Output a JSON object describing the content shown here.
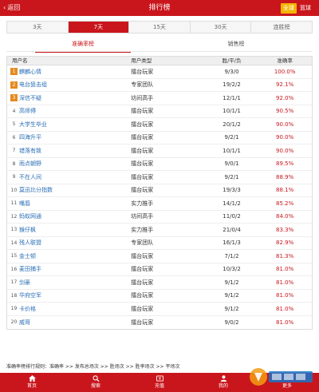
{
  "header": {
    "back_label": "返回",
    "title": "排行榜",
    "ball_label": "全球",
    "sport_label": "篮球"
  },
  "periods": [
    {
      "label": "3天",
      "active": false
    },
    {
      "label": "7天",
      "active": true
    },
    {
      "label": "15天",
      "active": false
    },
    {
      "label": "30天",
      "active": false
    },
    {
      "label": "连胜榜",
      "active": false
    }
  ],
  "subtabs": {
    "accuracy": "准确率榜",
    "sales": "销售榜"
  },
  "table": {
    "headers": {
      "user": "用户名",
      "type": "用户类型",
      "record": "胜/平/负",
      "rate": "准确率"
    },
    "rows": [
      {
        "rank": "1",
        "name": "麒麟心情",
        "type": "擂台玩家",
        "record": "9/3/0",
        "rate": "100.0%"
      },
      {
        "rank": "2",
        "name": "电台狙击组",
        "type": "专家团队",
        "record": "19/2/2",
        "rate": "92.1%"
      },
      {
        "rank": "3",
        "name": "深信不疑",
        "type": "坊间高手",
        "record": "12/1/1",
        "rate": "92.0%"
      },
      {
        "rank": "4",
        "name": "高师傅",
        "type": "擂台玩家",
        "record": "10/1/1",
        "rate": "90.5%"
      },
      {
        "rank": "5",
        "name": "大学生毕业",
        "type": "擂台玩家",
        "record": "20/1/2",
        "rate": "90.0%"
      },
      {
        "rank": "6",
        "name": "四海升平",
        "type": "擂台玩家",
        "record": "9/2/1",
        "rate": "90.0%"
      },
      {
        "rank": "7",
        "name": "错落有致",
        "type": "擂台玩家",
        "record": "10/1/1",
        "rate": "90.0%"
      },
      {
        "rank": "8",
        "name": "雨点朝野",
        "type": "擂台玩家",
        "record": "9/0/1",
        "rate": "89.5%"
      },
      {
        "rank": "9",
        "name": "不在人间",
        "type": "擂台玩家",
        "record": "9/2/1",
        "rate": "88.9%"
      },
      {
        "rank": "10",
        "name": "莫迅比分指数",
        "type": "擂台玩家",
        "record": "19/3/3",
        "rate": "88.1%"
      },
      {
        "rank": "11",
        "name": "嘴唇",
        "type": "实力推手",
        "record": "14/1/2",
        "rate": "85.2%"
      },
      {
        "rank": "12",
        "name": "蚂蚁网通",
        "type": "坊间高手",
        "record": "11/0/2",
        "rate": "84.0%"
      },
      {
        "rank": "13",
        "name": "猴仔枫",
        "type": "实力推手",
        "record": "21/0/4",
        "rate": "83.3%"
      },
      {
        "rank": "14",
        "name": "残人联盟",
        "type": "专家团队",
        "record": "16/1/3",
        "rate": "82.9%"
      },
      {
        "rank": "15",
        "name": "金士顿",
        "type": "擂台玩家",
        "record": "7/1/2",
        "rate": "81.3%"
      },
      {
        "rank": "16",
        "name": "麦田捕手",
        "type": "擂台玩家",
        "record": "10/3/2",
        "rate": "81.0%"
      },
      {
        "rank": "17",
        "name": "剑豪",
        "type": "擂台玩家",
        "record": "9/1/2",
        "rate": "81.0%"
      },
      {
        "rank": "18",
        "name": "华府空军",
        "type": "擂台玩家",
        "record": "9/1/2",
        "rate": "81.0%"
      },
      {
        "rank": "19",
        "name": "卡价格",
        "type": "擂台玩家",
        "record": "9/1/2",
        "rate": "81.0%"
      },
      {
        "rank": "20",
        "name": "威哥",
        "type": "擂台玩家",
        "record": "9/0/2",
        "rate": "81.0%"
      }
    ]
  },
  "note": "准确率榜排行规则：准确率 >> 发布总场次 >> 胜场次 >> 胜率场次 >> 平场次",
  "bottom_nav": [
    {
      "label": "首页",
      "icon": "home-icon"
    },
    {
      "label": "搜索",
      "icon": "search-icon"
    },
    {
      "label": "充值",
      "icon": "recharge-icon"
    },
    {
      "label": "我的",
      "icon": "user-icon"
    },
    {
      "label": "更多",
      "icon": "more-icon"
    }
  ],
  "colors": {
    "brand_red": "#c9161c",
    "ball_yellow": "#f4b400",
    "top_rank_orange": "#e58a1f",
    "name_blue": "#2b6fb6"
  }
}
